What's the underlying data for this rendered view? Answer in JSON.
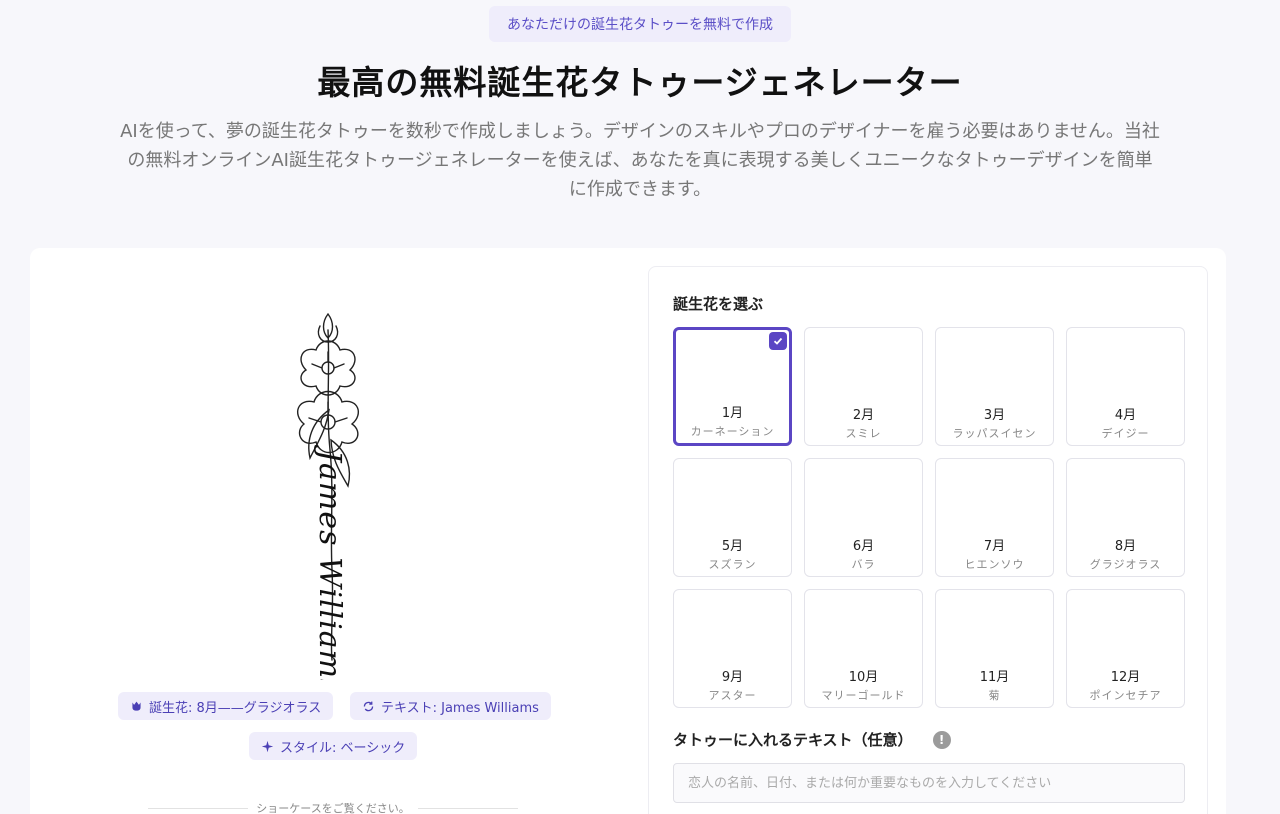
{
  "hero": {
    "badge": "あなただけの誕生花タトゥーを無料で作成",
    "title": "最高の無料誕生花タトゥージェネレーター",
    "description": "AIを使って、夢の誕生花タトゥーを数秒で作成しましょう。デザインのスキルやプロのデザイナーを雇う必要はありません。当社の無料オンラインAI誕生花タトゥージェネレーターを使えば、あなたを真に表現する美しくユニークなタトゥーデザインを簡単に作成できます。"
  },
  "preview": {
    "tattoo_text": "James Williams",
    "chips": {
      "flower": "誕生花: 8月——グラジオラス",
      "text": "テキスト: James Williams",
      "style": "スタイル: ベーシック"
    },
    "showcase_label": "ショーケースをご覧ください。"
  },
  "panel": {
    "select_title": "誕生花を選ぶ",
    "flowers": [
      {
        "month": "1月",
        "name": "カーネーション",
        "selected": true
      },
      {
        "month": "2月",
        "name": "スミレ",
        "selected": false
      },
      {
        "month": "3月",
        "name": "ラッパスイセン",
        "selected": false
      },
      {
        "month": "4月",
        "name": "デイジー",
        "selected": false
      },
      {
        "month": "5月",
        "name": "スズラン",
        "selected": false
      },
      {
        "month": "6月",
        "name": "バラ",
        "selected": false
      },
      {
        "month": "7月",
        "name": "ヒエンソウ",
        "selected": false
      },
      {
        "month": "8月",
        "name": "グラジオラス",
        "selected": false
      },
      {
        "month": "9月",
        "name": "アスター",
        "selected": false
      },
      {
        "month": "10月",
        "name": "マリーゴールド",
        "selected": false
      },
      {
        "month": "11月",
        "name": "菊",
        "selected": false
      },
      {
        "month": "12月",
        "name": "ポインセチア",
        "selected": false
      }
    ],
    "text_label": "タトゥーに入れるテキスト（任意）",
    "info_icon": "!",
    "text_placeholder": "恋人の名前、日付、または何か重要なものを入力してください"
  },
  "colors": {
    "accent": "#5b46c4",
    "chip_bg": "#efedfb"
  }
}
